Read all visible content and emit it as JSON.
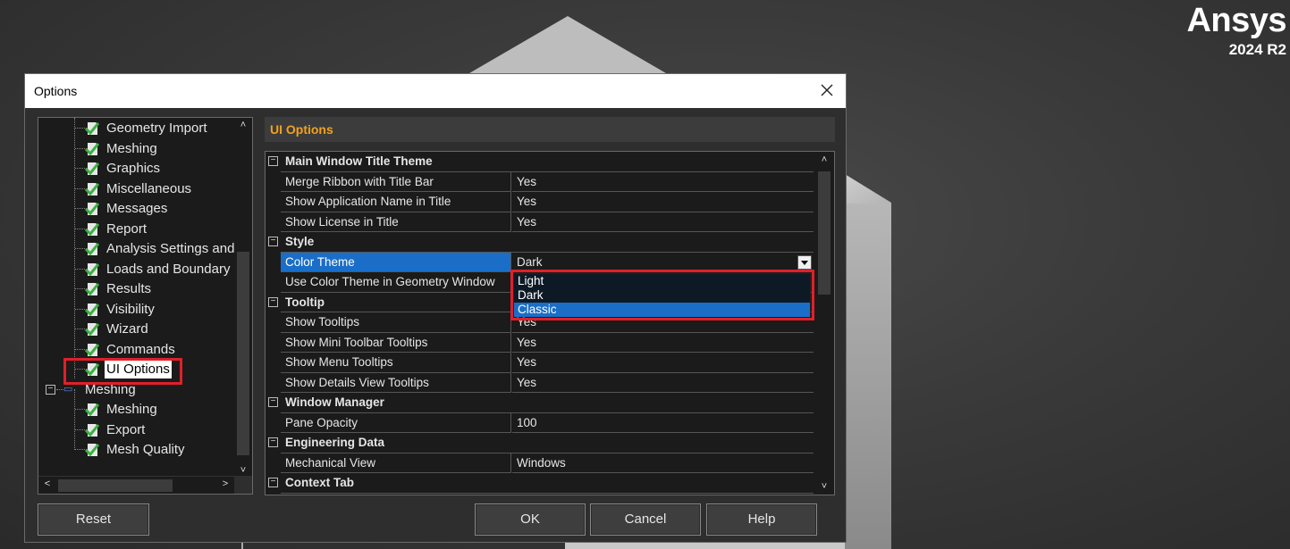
{
  "logo": {
    "word": "Ansys",
    "version": "2024 R2"
  },
  "dialog": {
    "title": "Options"
  },
  "tree": {
    "items": [
      {
        "label": "Geometry Import"
      },
      {
        "label": "Meshing"
      },
      {
        "label": "Graphics"
      },
      {
        "label": "Miscellaneous"
      },
      {
        "label": "Messages"
      },
      {
        "label": "Report"
      },
      {
        "label": "Analysis Settings and"
      },
      {
        "label": "Loads and Boundary"
      },
      {
        "label": "Results"
      },
      {
        "label": "Visibility"
      },
      {
        "label": "Wizard"
      },
      {
        "label": "Commands"
      },
      {
        "label": "UI Options",
        "selected": true
      },
      {
        "label": "Meshing",
        "group": true
      },
      {
        "label": "Meshing"
      },
      {
        "label": "Export"
      },
      {
        "label": "Mesh Quality"
      }
    ]
  },
  "panel": {
    "header": "UI Options",
    "rows": [
      {
        "type": "section",
        "name": "Main Window Title Theme"
      },
      {
        "name": "Merge Ribbon with Title Bar",
        "value": "Yes"
      },
      {
        "name": "Show Application Name in Title",
        "value": "Yes"
      },
      {
        "name": "Show License in Title",
        "value": "Yes"
      },
      {
        "type": "section",
        "name": "Style"
      },
      {
        "name": "Color Theme",
        "value": "Dark",
        "highlight": true
      },
      {
        "name": "Use Color Theme in Geometry Window",
        "value": ""
      },
      {
        "type": "section",
        "name": "Tooltip"
      },
      {
        "name": "Show Tooltips",
        "value": "Yes"
      },
      {
        "name": "Show Mini Toolbar Tooltips",
        "value": "Yes"
      },
      {
        "name": "Show Menu Tooltips",
        "value": "Yes"
      },
      {
        "name": "Show Details View Tooltips",
        "value": "Yes"
      },
      {
        "type": "section",
        "name": "Window Manager"
      },
      {
        "name": "Pane Opacity",
        "value": "100"
      },
      {
        "type": "section",
        "name": "Engineering Data"
      },
      {
        "name": "Mechanical View",
        "value": "Windows"
      },
      {
        "type": "section",
        "name": "Context Tab"
      }
    ],
    "dropdown": {
      "options": [
        "Light",
        "Dark",
        "Classic"
      ],
      "selected": "Classic"
    }
  },
  "buttons": {
    "reset": "Reset",
    "ok": "OK",
    "cancel": "Cancel",
    "help": "Help"
  },
  "colors": {
    "accent": "#f0a21e",
    "selection": "#1a6ec7",
    "highlight_box": "#e0202a",
    "check": "#3cb043"
  }
}
